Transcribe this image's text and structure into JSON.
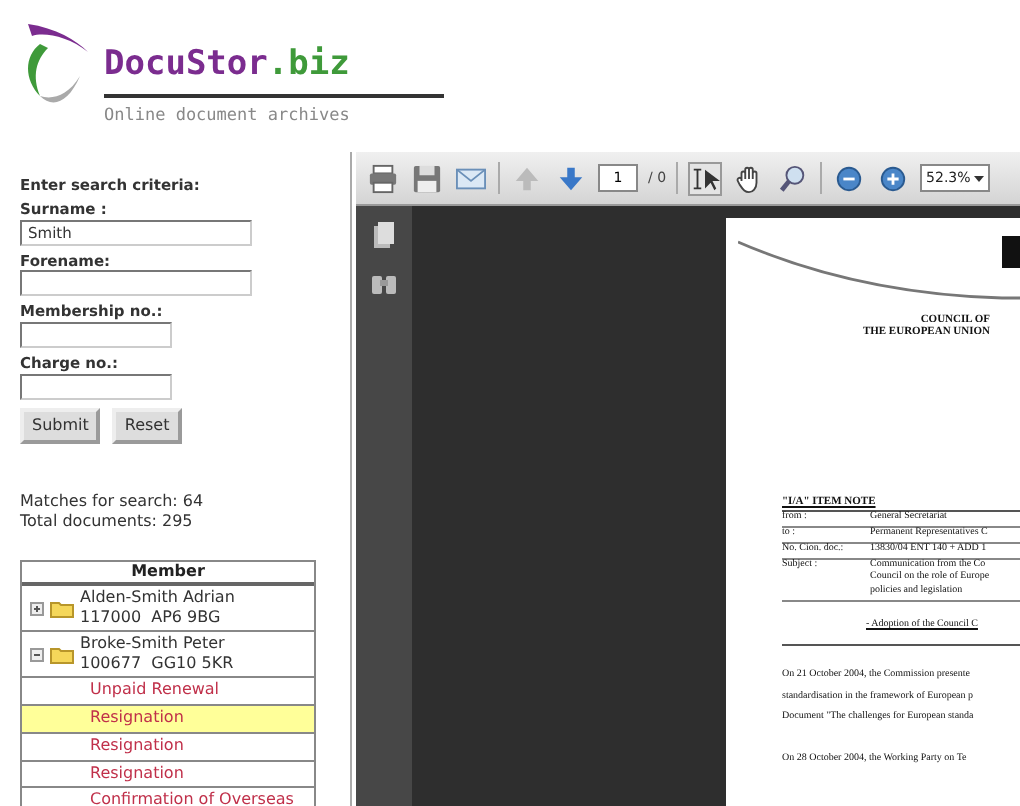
{
  "logo": {
    "brand_main": "DocuStor",
    "brand_suffix": ".biz",
    "tagline": "Online document archives"
  },
  "search_form": {
    "heading": "Enter search criteria:",
    "fields": [
      {
        "label": "Surname :",
        "value": "Smith",
        "kind": "long"
      },
      {
        "label": "Forename:",
        "kind": "long"
      },
      {
        "label": "Membership no.:",
        "kind": "short"
      },
      {
        "label": "Charge no.:",
        "kind": "short"
      }
    ],
    "buttons": [
      "Submit",
      "Reset"
    ]
  },
  "results": {
    "matches": "Matches for search: 64",
    "total": "Total documents: 295"
  },
  "member_table": {
    "header": "Member",
    "rows": [
      {
        "name": "Alden-Smith Adrian",
        "details": "117000  AP6 9BG",
        "expanded": false
      },
      {
        "name": "Broke-Smith Peter",
        "details": "100677  GG10 5KR",
        "expanded": true,
        "children": [
          {
            "label": "Unpaid Renewal",
            "selected": false
          },
          {
            "label": "Resignation",
            "selected": true
          },
          {
            "label": "Resignation",
            "selected": false
          },
          {
            "label": "Resignation",
            "selected": false
          },
          {
            "label": "Confirmation of Overseas",
            "selected": false
          }
        ]
      }
    ]
  },
  "viewer": {
    "toolbar": [
      {
        "kind": "print"
      },
      {
        "kind": "save"
      },
      {
        "kind": "email"
      },
      {
        "kind": "sep"
      },
      {
        "kind": "prev",
        "disabled": true
      },
      {
        "kind": "next",
        "disabled": false
      },
      {
        "kind": "page",
        "value": "1",
        "total": "/ 0"
      },
      {
        "kind": "sep"
      },
      {
        "kind": "select",
        "selected": true
      },
      {
        "kind": "hand",
        "selected": false
      },
      {
        "kind": "zoomtool",
        "selected": false
      },
      {
        "kind": "sep"
      },
      {
        "kind": "zoomout"
      },
      {
        "kind": "zoomin"
      },
      {
        "kind": "zoomfield",
        "value": "52.3%"
      }
    ],
    "document": {
      "header": [
        "COUNCIL OF",
        "THE EUROPEAN UNION"
      ],
      "note_title": "\"I/A\" ITEM NOTE",
      "fields": [
        {
          "label": "from :",
          "lines": [
            "General Secretariat"
          ]
        },
        {
          "label": "to :",
          "lines": [
            "Permanent Representatives C"
          ]
        },
        {
          "label": "No. Cion. doc.:",
          "lines": [
            "13830/04 ENT 140 + ADD 1"
          ]
        },
        {
          "label": "Subject :",
          "lines": [
            "Communication from the Co",
            "Council on the role of Europe",
            "policies and legislation"
          ]
        }
      ],
      "adoption": "-   Adoption of the Council C",
      "paragraphs": [
        [
          "On 21 October 2004, the Commission presente",
          "standardisation in the framework of European p",
          "Document \"The challenges for European standa"
        ],
        [
          "On 28 October 2004, the Working Party on Te"
        ]
      ]
    }
  }
}
